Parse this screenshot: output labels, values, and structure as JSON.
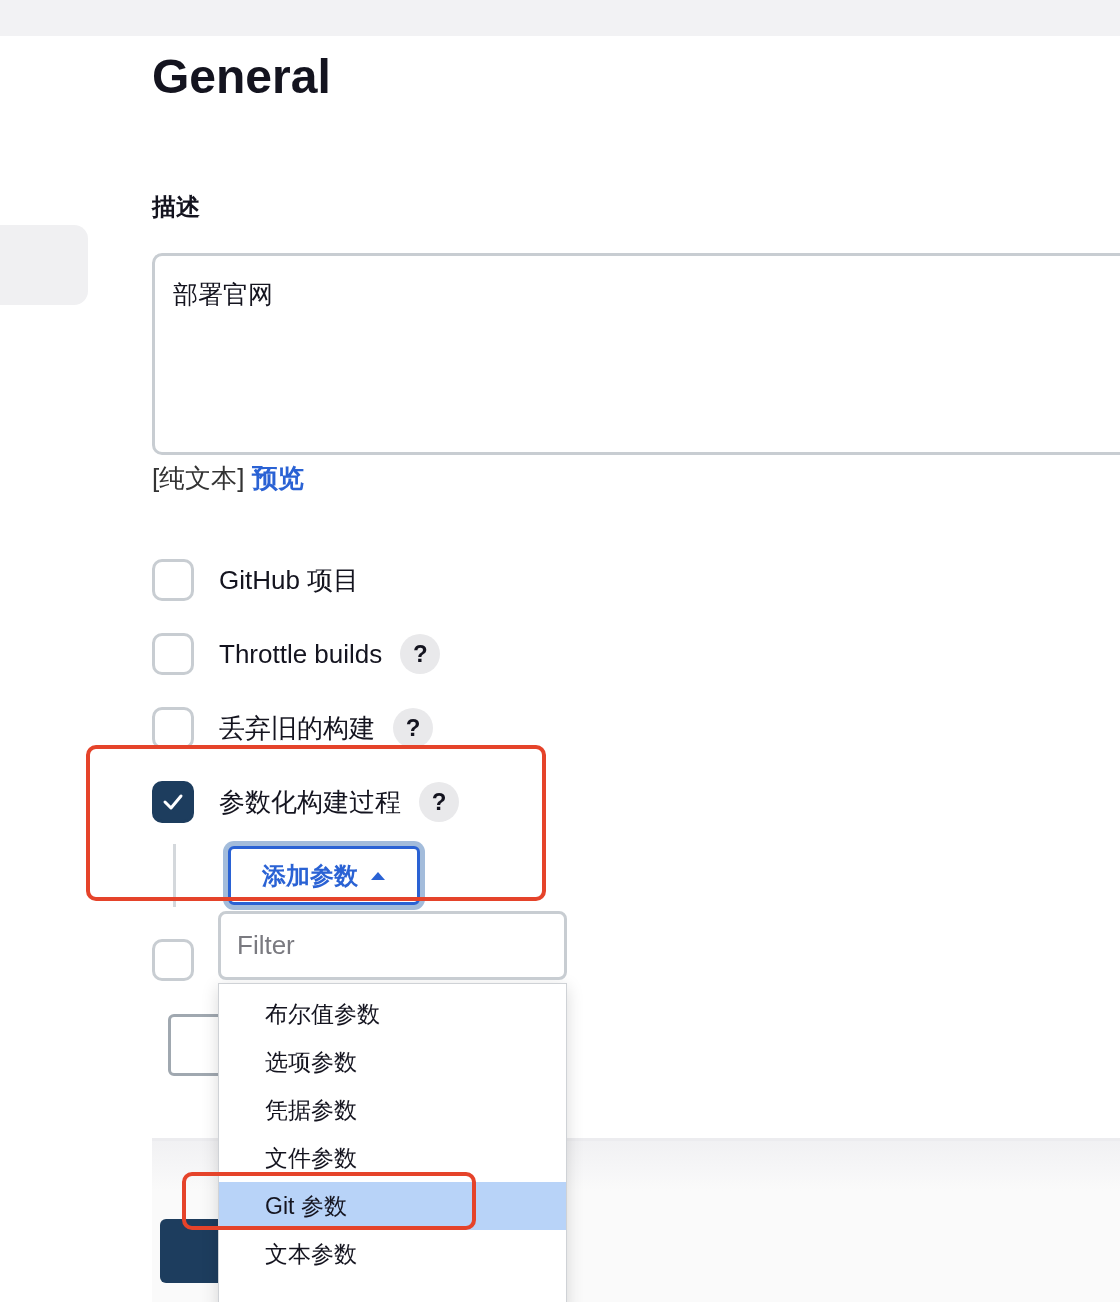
{
  "header": {
    "title": "General"
  },
  "description": {
    "label": "描述",
    "value": "部署官网",
    "format_label": "[纯文本]",
    "preview_link": "预览"
  },
  "options": [
    {
      "label": "GitHub 项目",
      "checked": false
    },
    {
      "label": "Throttle builds",
      "checked": false,
      "help": "?"
    },
    {
      "label": "丢弃旧的构建",
      "checked": false,
      "help": "?"
    },
    {
      "label": "参数化构建过程",
      "checked": true,
      "help": "?"
    }
  ],
  "add_parameter": {
    "label": "添加参数",
    "expanded": true
  },
  "extra_checkbox": {
    "checked": false
  },
  "filter": {
    "placeholder": "Filter"
  },
  "menu": [
    {
      "label": "布尔值参数",
      "selected": false
    },
    {
      "label": "选项参数",
      "selected": false
    },
    {
      "label": "凭据参数",
      "selected": false
    },
    {
      "label": "文件参数",
      "selected": false
    },
    {
      "label": "Git 参数",
      "selected": true
    },
    {
      "label": "文本参数",
      "selected": false
    }
  ]
}
